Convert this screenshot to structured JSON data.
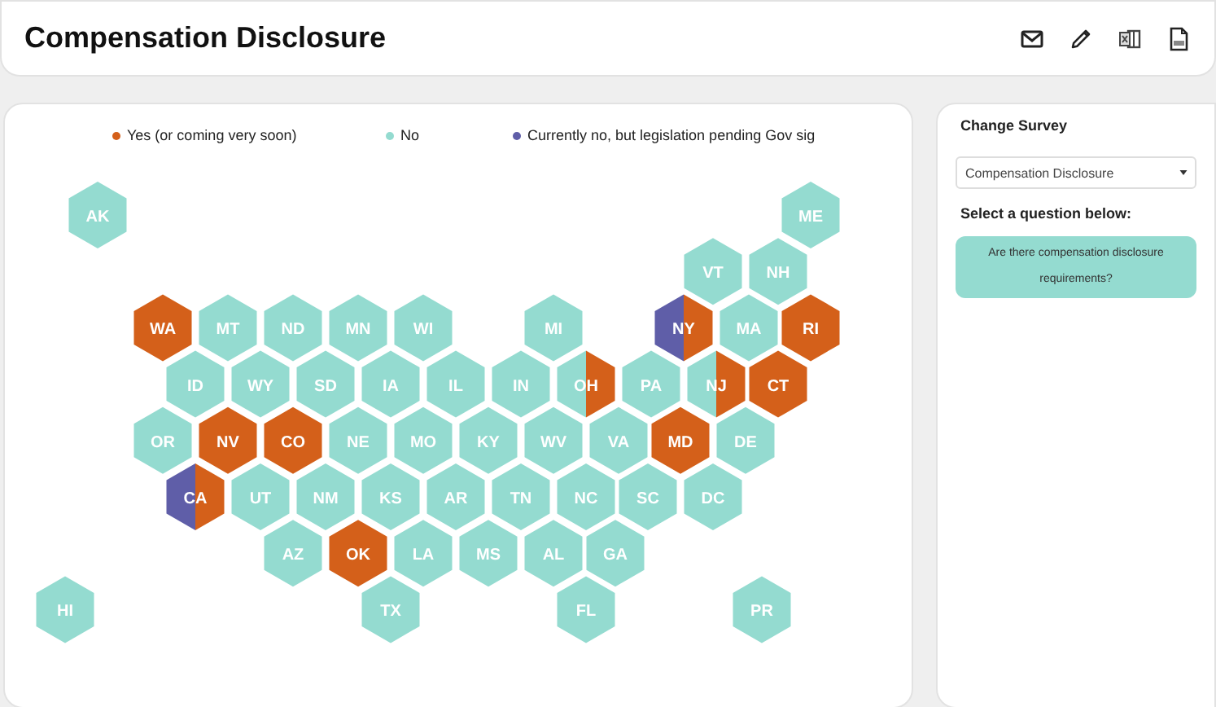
{
  "header": {
    "title": "Compensation Disclosure"
  },
  "legend": [
    {
      "label": "Yes (or coming very soon)",
      "color": "#d4601a"
    },
    {
      "label": "No",
      "color": "#94dbd0"
    },
    {
      "label": "Currently no, but legislation pending Gov sig",
      "color": "#5f5ea8"
    }
  ],
  "states": [
    {
      "label": "AK",
      "color": "#94dbd0"
    },
    {
      "label": "ME",
      "color": "#94dbd0"
    },
    {
      "label": "VT",
      "color": "#94dbd0"
    },
    {
      "label": "NH",
      "color": "#94dbd0"
    },
    {
      "label": "WA",
      "color": "#d4601a"
    },
    {
      "label": "MT",
      "color": "#94dbd0"
    },
    {
      "label": "ND",
      "color": "#94dbd0"
    },
    {
      "label": "MN",
      "color": "#94dbd0"
    },
    {
      "label": "WI",
      "color": "#94dbd0"
    },
    {
      "label": "MI",
      "color": "#94dbd0"
    },
    {
      "label": "NY",
      "halves": [
        {
          "color": "#5f5ea8"
        },
        {
          "color": "#d4601a"
        }
      ]
    },
    {
      "label": "MA",
      "color": "#94dbd0"
    },
    {
      "label": "RI",
      "color": "#d4601a"
    },
    {
      "label": "ID",
      "color": "#94dbd0"
    },
    {
      "label": "WY",
      "color": "#94dbd0"
    },
    {
      "label": "SD",
      "color": "#94dbd0"
    },
    {
      "label": "IA",
      "color": "#94dbd0"
    },
    {
      "label": "IL",
      "color": "#94dbd0"
    },
    {
      "label": "IN",
      "color": "#94dbd0"
    },
    {
      "label": "OH",
      "halves": [
        {
          "color": "#94dbd0"
        },
        {
          "color": "#d4601a"
        }
      ]
    },
    {
      "label": "PA",
      "color": "#94dbd0"
    },
    {
      "label": "NJ",
      "halves": [
        {
          "color": "#94dbd0"
        },
        {
          "color": "#d4601a"
        }
      ]
    },
    {
      "label": "CT",
      "color": "#d4601a"
    },
    {
      "label": "OR",
      "color": "#94dbd0"
    },
    {
      "label": "NV",
      "color": "#d4601a"
    },
    {
      "label": "CO",
      "color": "#d4601a"
    },
    {
      "label": "NE",
      "color": "#94dbd0"
    },
    {
      "label": "MO",
      "color": "#94dbd0"
    },
    {
      "label": "KY",
      "color": "#94dbd0"
    },
    {
      "label": "WV",
      "color": "#94dbd0"
    },
    {
      "label": "VA",
      "color": "#94dbd0"
    },
    {
      "label": "MD",
      "color": "#d4601a"
    },
    {
      "label": "DE",
      "color": "#94dbd0"
    },
    {
      "label": "CA",
      "halves": [
        {
          "color": "#5f5ea8"
        },
        {
          "color": "#d4601a"
        }
      ]
    },
    {
      "label": "UT",
      "color": "#94dbd0"
    },
    {
      "label": "NM",
      "color": "#94dbd0"
    },
    {
      "label": "KS",
      "color": "#94dbd0"
    },
    {
      "label": "AR",
      "color": "#94dbd0"
    },
    {
      "label": "TN",
      "color": "#94dbd0"
    },
    {
      "label": "NC",
      "color": "#94dbd0"
    },
    {
      "label": "SC",
      "color": "#94dbd0"
    },
    {
      "label": "DC",
      "color": "#94dbd0"
    },
    {
      "label": "AZ",
      "color": "#94dbd0"
    },
    {
      "label": "OK",
      "color": "#d4601a"
    },
    {
      "label": "LA",
      "color": "#94dbd0"
    },
    {
      "label": "MS",
      "color": "#94dbd0"
    },
    {
      "label": "AL",
      "color": "#94dbd0"
    },
    {
      "label": "GA",
      "color": "#94dbd0"
    },
    {
      "label": "HI",
      "color": "#94dbd0"
    },
    {
      "label": "TX",
      "color": "#94dbd0"
    },
    {
      "label": "FL",
      "color": "#94dbd0"
    },
    {
      "label": "PR",
      "color": "#94dbd0"
    }
  ],
  "panel": {
    "heading": "Change Survey",
    "survey": "Compensation Disclosure",
    "question_heading": "Select a question below:",
    "questions": [
      {
        "label": "Are there compensation disclosure requirements?",
        "selected": true
      }
    ]
  }
}
